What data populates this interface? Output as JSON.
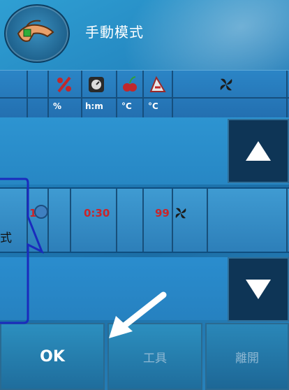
{
  "header": {
    "title": "手動模式",
    "mode_icon": "hand-icon"
  },
  "columns": {
    "icons": [
      "percent-icon",
      "clock-icon",
      "temperature-icon",
      "thermometer-icon",
      "fan-icon"
    ],
    "units": [
      "%",
      "h:m",
      "°C",
      "°C"
    ]
  },
  "data_row": {
    "power": "1",
    "time": "0:30",
    "temp": "99",
    "fan_icon": "fan-icon",
    "status_icon": "circle-icon"
  },
  "buttons": {
    "ok": "OK",
    "tools": "工具",
    "close": "離開"
  },
  "scroll": {
    "up_icon": "arrow-up-icon",
    "down_icon": "arrow-down-icon"
  },
  "callout": {
    "text": "式"
  },
  "colors": {
    "value_red": "#c9252b",
    "callout_border": "#1a2bbd",
    "pointer_arrow": "#ffffff"
  }
}
